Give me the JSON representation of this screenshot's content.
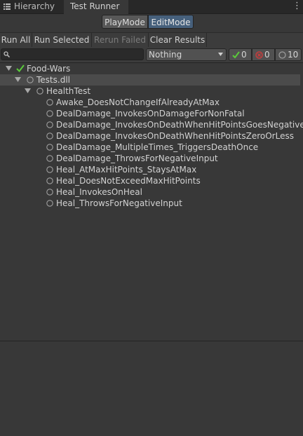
{
  "tabs": {
    "hierarchy": "Hierarchy",
    "runner": "Test Runner"
  },
  "mode": {
    "play": "PlayMode",
    "edit": "EditMode",
    "active": "EditMode"
  },
  "toolbar": {
    "run_all": "Run All",
    "run_selected": "Run Selected",
    "rerun_failed": "Rerun Failed",
    "clear_results": "Clear Results"
  },
  "filter": {
    "search_value": "",
    "dropdown_value": "Nothing",
    "passed_count": "0",
    "failed_count": "0",
    "skipped_count": "10"
  },
  "tree": {
    "root": "Food-Wars",
    "assembly": "Tests.dll",
    "fixture": "HealthTest",
    "tests": [
      "Awake_DoesNotChangeIfAlreadyAtMax",
      "DealDamage_InvokesOnDamageForNonFatal",
      "DealDamage_InvokesOnDeathWhenHitPointsGoesNegative",
      "DealDamage_InvokesOnDeathWhenHitPointsZeroOrLess",
      "DealDamage_MultipleTimes_TriggersDeathOnce",
      "DealDamage_ThrowsForNegativeInput",
      "Heal_AtMaxHitPoints_StaysAtMax",
      "Heal_DoesNotExceedMaxHitPoints",
      "Heal_InvokesOnHeal",
      "Heal_ThrowsForNegativeInput"
    ]
  },
  "colors": {
    "background": "#383838",
    "active_mode": "#46607c",
    "pass_green": "#5bcb3b",
    "fail_red": "#c83c3c",
    "not_run": "#a0a0a0"
  },
  "icons": {
    "hierarchy_tab": "list-icon",
    "menu": "kebab-menu-icon",
    "search": "search-icon",
    "dropdown": "chevron-down-icon",
    "passed": "check-icon",
    "failed": "fail-circle-icon",
    "not_run": "empty-circle-icon",
    "expand": "triangle-down-icon"
  }
}
